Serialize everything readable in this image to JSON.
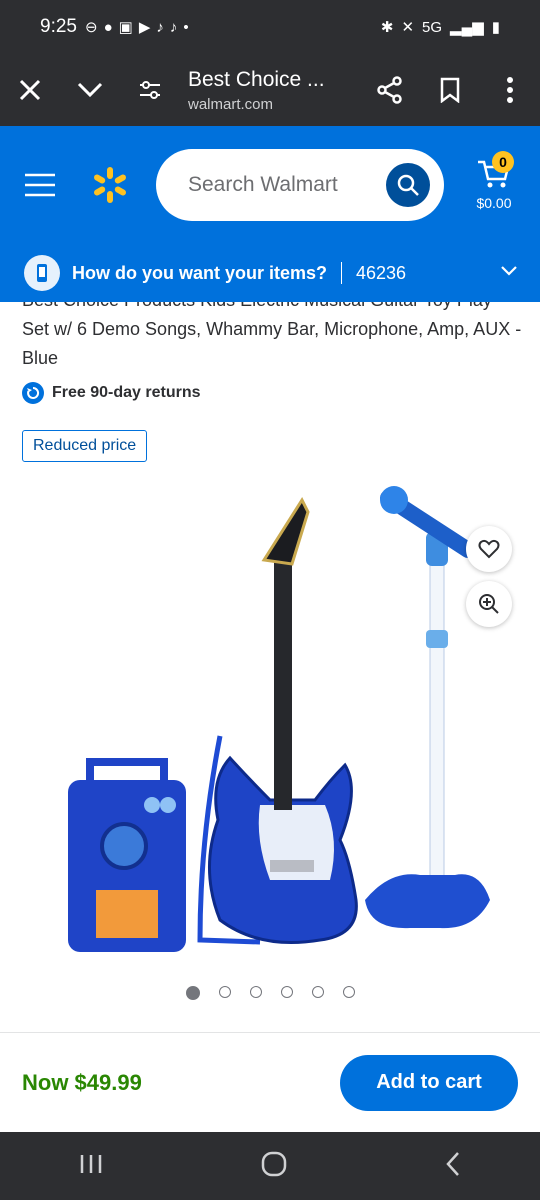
{
  "status": {
    "time": "9:25",
    "network": "5G"
  },
  "browser": {
    "title": "Best Choice ...",
    "url": "walmart.com"
  },
  "header": {
    "search_placeholder": "Search Walmart",
    "cart_count": "0",
    "cart_amount": "$0.00"
  },
  "fulfillment": {
    "question": "How do you want your items?",
    "zip": "46236"
  },
  "product": {
    "title": "Best Choice Products Kids Electric Musical Guitar Toy Play Set w/ 6 Demo Songs, Whammy Bar, Microphone, Amp, AUX - Blue",
    "returns_label": "Free 90-day returns",
    "badge": "Reduced price",
    "image_count": 6,
    "active_image": 1
  },
  "purchase": {
    "price": "Now $49.99",
    "add_to_cart": "Add to cart"
  },
  "colors": {
    "walmart_blue": "#0071dc",
    "dark_blue": "#004f9a",
    "spark_yellow": "#ffc220",
    "price_green": "#2a8703"
  }
}
